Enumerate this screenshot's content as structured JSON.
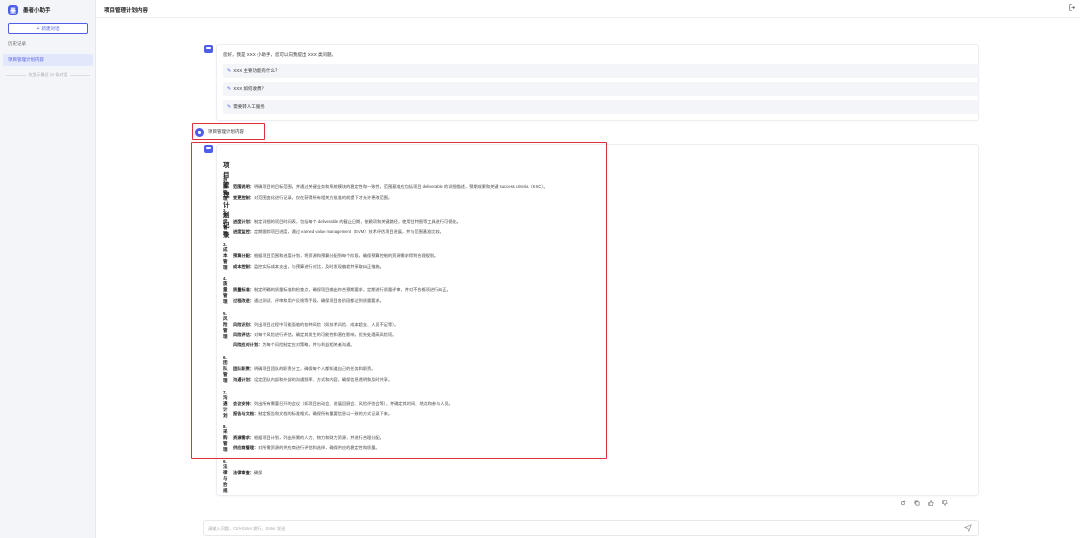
{
  "app": {
    "name": "墨者小助手",
    "logo_glyph": "墨"
  },
  "sidebar": {
    "new_chat_label": "新建对话",
    "history_title": "历史记录",
    "history_items": [
      {
        "label": "项目管理计划内容"
      }
    ],
    "history_end_text": "仅显示最近 20 条对话"
  },
  "header": {
    "title": "项目管理计划内容"
  },
  "greeting": {
    "text": "您好，我是 XXX 小助手，您可以向我提出 XXX 类问题。",
    "suggestions": [
      "XXX 主要功能有什么？",
      "XXX 如何收费？",
      "需要转人工服务"
    ]
  },
  "user_message": {
    "text": "项目管理计划内容"
  },
  "answer": {
    "title": "项目管理计划记录",
    "sections": [
      {
        "heading": "1. 范围管理",
        "items": [
          {
            "label": "范围说明：",
            "text": "明确项目的目标范围，并通过关键业务和系统模块的稳定性和一致性，范围基准应包括项目 deliverable 的详细描述，预期成果和关键 success criteria（KSC）。"
          },
          {
            "label": "变更控制：",
            "text": "对范围变化进行记录，仅在获得所有相关方批准的前提下才允许更改范围。"
          }
        ]
      },
      {
        "heading": "2. 进度管理",
        "items": [
          {
            "label": "进度计划：",
            "text": "制定详细的项目时间表，包括每个 deliverable 的截止日期，依赖项和关键路径，使用甘特图等工具进行可视化。"
          },
          {
            "label": "进度监控：",
            "text": "定期跟踪项目进度，通过 earned value management（EVM）技术评估项目进展，并与范围基准比较。"
          }
        ]
      },
      {
        "heading": "3. 成本管理",
        "items": [
          {
            "label": "预算分配：",
            "text": "根据项目范围和进度计划，将资源和预算分配到每个阶段，确保预算控制的资源需求得到合理规划。"
          },
          {
            "label": "成本控制：",
            "text": "监控实际成本支出，与预算进行对比，及时发现偏差并采取纠正措施。"
          }
        ]
      },
      {
        "heading": "4. 质量管理",
        "items": [
          {
            "label": "质量标准：",
            "text": "制定明确的质量标准和检查点，确保项目输出符合预期要求，定期进行质量评审，并对不合格项进行纠正。"
          },
          {
            "label": "过程改进：",
            "text": "通过测试、评审和用户反馈等手段，确保项目各阶段都达到质量要求。"
          }
        ]
      },
      {
        "heading": "5. 风险管理",
        "items": [
          {
            "label": "风险识别：",
            "text": "列出项目过程中可能面临的各种风险（如技术风险、成本超支、人员不足等）。"
          },
          {
            "label": "风险评估：",
            "text": "对每个风险进行评估，确定其发生的可能性和潜在影响，优先处理高风险项。"
          },
          {
            "label": "风险应对计划：",
            "text": "为每个风险制定应对策略，并与利益相关者沟通。"
          }
        ]
      },
      {
        "heading": "6. 团队管理",
        "items": [
          {
            "label": "团队职责：",
            "text": "明确项目团队的职责分工，确保每个人都知道自己的任务和职责。"
          },
          {
            "label": "沟通计划：",
            "text": "设定团队内部和外部的沟通频率、方式和内容，确保信息透明和及时共享。"
          }
        ]
      },
      {
        "heading": "7. 沟通计划",
        "items": [
          {
            "label": "会议安排：",
            "text": "列出所有需要召开的会议（如项目启动会、进展回顾会、风险评估会等），并确定其时间、地点和参与人员。"
          },
          {
            "label": "报告与文档：",
            "text": "制定报告和文档的标准格式，确保所有重要信息以一致的方式记录下来。"
          }
        ]
      },
      {
        "heading": "8. 采购管理",
        "items": [
          {
            "label": "资源需求：",
            "text": "根据项目计划，列出所需的人力、物力和财力资源，并进行合理分配。"
          },
          {
            "label": "供应商管理：",
            "text": "对所需资源的供应商进行评估和选择，确保供应的稳定性和质量。"
          }
        ]
      },
      {
        "heading": "9. 法律与合规",
        "items": [
          {
            "label": "法律审查：",
            "text": "确保"
          }
        ]
      }
    ],
    "cursor": "|"
  },
  "message_actions": [
    "refresh-icon",
    "copy-icon",
    "thumbs-up-icon",
    "thumbs-down-icon"
  ],
  "input": {
    "placeholder": "请输入问题，Ctrl+Enter 换行，Enter 发送"
  },
  "colors": {
    "accent": "#4f5ee8",
    "highlight_box": "#e0303b"
  }
}
